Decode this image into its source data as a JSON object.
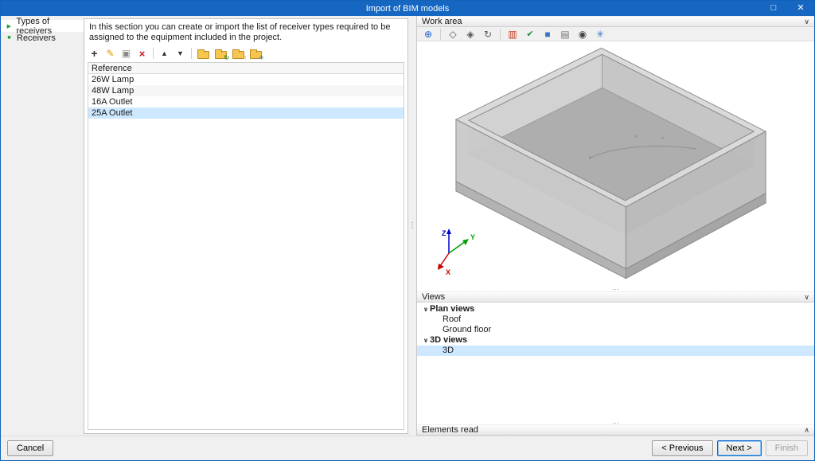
{
  "window": {
    "title": "Import of BIM models",
    "maximize_glyph": "□",
    "close_glyph": "✕"
  },
  "sidebar": {
    "items": [
      {
        "icon": "▶",
        "label": "Types of receivers",
        "active": true
      },
      {
        "icon": "■",
        "label": "Receivers",
        "active": false
      }
    ]
  },
  "main": {
    "description": "In this section you can create or import the list of receiver types required to be assigned to the equipment included in the project.",
    "toolbar": {
      "add": "+",
      "edit": "✎",
      "copy": "▣",
      "delete": "×",
      "move_up": "▲",
      "move_down": "▼",
      "folder_open_overlay": "",
      "folder_sync_overlay": "↻",
      "folder_up_overlay": "↑",
      "folder_gear_overlay": "✳"
    },
    "table": {
      "header": "Reference",
      "rows": [
        "26W Lamp",
        "48W Lamp",
        "16A Outlet",
        "25A Outlet"
      ],
      "selected_row": "25A Outlet",
      "selected_index": 3
    }
  },
  "right": {
    "work_area": {
      "title": "Work area",
      "collapse_glyph": "∨",
      "toolbar": {
        "coordinate": "⊕",
        "orbit": "◇",
        "viewcube": "◈",
        "rotate": "↻",
        "structure": "▥",
        "check": "✔",
        "solid": "■",
        "layers": "▤",
        "visibility": "◉",
        "wireframe": "✳"
      }
    },
    "axes": {
      "x": "X",
      "y": "Y",
      "z": "Z"
    },
    "views": {
      "title": "Views",
      "collapse_glyph": "∨",
      "expander": "∨",
      "tree": [
        {
          "label": "Plan views",
          "type": "group"
        },
        {
          "label": "Roof",
          "type": "item"
        },
        {
          "label": "Ground floor",
          "type": "item"
        },
        {
          "label": "3D views",
          "type": "group"
        },
        {
          "label": "3D",
          "type": "item",
          "selected": true
        }
      ],
      "selected": "3D"
    },
    "elements_read": {
      "title": "Elements read",
      "collapse_glyph": "∧"
    }
  },
  "splitters": {
    "vertical_grip": "⋮",
    "horizontal_grip": "…"
  },
  "footer": {
    "cancel": "Cancel",
    "previous": "< Previous",
    "next": "Next >",
    "finish": "Finish"
  },
  "colors": {
    "titlebar": "#1667c1",
    "selection": "#cde8ff",
    "axis_x": "#cc0000",
    "axis_y": "#00a000",
    "axis_z": "#0000cc"
  }
}
